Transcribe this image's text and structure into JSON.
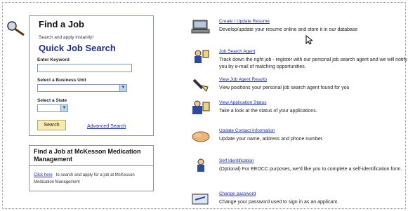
{
  "search_panel": {
    "title": "Find a Job",
    "subtitle": "Search and apply instantly!",
    "heading": "Quick Job Search",
    "keyword_label": "Enter Keyword",
    "keyword_value": "",
    "business_unit_label": "Select a Business Unit",
    "business_unit_value": "",
    "state_label": "Select a State",
    "state_value": "",
    "search_button": "Search",
    "advanced_link": "Advanced Search"
  },
  "mckesson_panel": {
    "title": "Find a Job at McKesson Medication Management",
    "link": "Click here",
    "text": "to search and apply for a job at McKesson Medication Management"
  },
  "items": [
    {
      "title": "Create / Update Resume",
      "desc": "Develop/update your resume online and store it in our database",
      "icon": "computer-icon"
    },
    {
      "title": "Job Search Agent",
      "desc": "Track down the right job - register with our personal job search agent and we will notify you by e-mail of matching opportunities.",
      "icon": "agent-icon"
    },
    {
      "title": "View Job Agent Results",
      "desc": "View positions your personal job search agent found for you",
      "icon": "flashlight-icon"
    },
    {
      "title": "View Application Status",
      "desc": "Take a look at the status of your applications.",
      "icon": "status-icon"
    },
    {
      "title": "Update Contact Information",
      "desc": "Update your name, address and phone number.",
      "icon": "handshake-icon"
    },
    {
      "title": "Self Identification",
      "desc": "(Optional) For EEOCC purposes, we'd like you to complete a self-identification form.",
      "icon": "person-icon"
    },
    {
      "title": "Change password",
      "desc": "Change your password used to sign in as an applicant.",
      "icon": "password-icon"
    }
  ]
}
